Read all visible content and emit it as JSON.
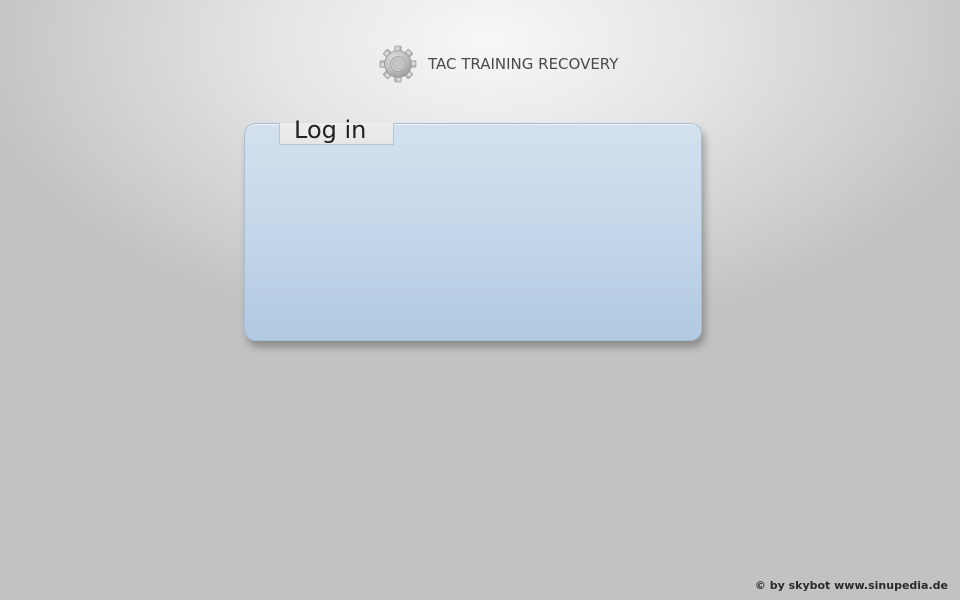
{
  "header": {
    "icon": "gear-icon",
    "title": "TAC TRAINING RECOVERY"
  },
  "login_panel": {
    "title": "Log in"
  },
  "footer": {
    "credit": "© by skybot www.sinupedia.de"
  },
  "colors": {
    "panel_top": "#d3e1ee",
    "panel_bottom": "#b1c9e2",
    "panel_border": "#a9bed4",
    "tab_background": "#eeeeee",
    "title_text": "#4a4a4a"
  }
}
